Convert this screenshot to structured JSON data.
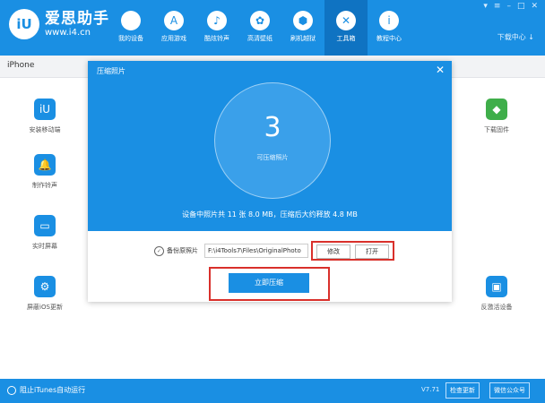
{
  "header": {
    "logo_badge": "iU",
    "logo_title": "爱思助手",
    "logo_url": "www.i4.cn",
    "nav": [
      {
        "label": "我的设备",
        "icon": "apple-icon",
        "glyph": ""
      },
      {
        "label": "应用游戏",
        "icon": "appstore-icon",
        "glyph": "A"
      },
      {
        "label": "酷炫铃声",
        "icon": "bell-icon",
        "glyph": "♪"
      },
      {
        "label": "高清壁纸",
        "icon": "flower-icon",
        "glyph": "✿"
      },
      {
        "label": "刷机越狱",
        "icon": "box-icon",
        "glyph": "⬢"
      },
      {
        "label": "工具箱",
        "icon": "wrench-icon",
        "glyph": "✕"
      },
      {
        "label": "教程中心",
        "icon": "info-icon",
        "glyph": "i"
      }
    ],
    "download_center": "下载中心 ↓",
    "window_controls": [
      "▾",
      "≡",
      "–",
      "□",
      "✕"
    ]
  },
  "tabs": {
    "active": "iPhone"
  },
  "tools_left": [
    {
      "label": "安装移动端",
      "color": "#1a8fe3",
      "glyph": "iU"
    },
    {
      "label": "制作铃声",
      "color": "#1a8fe3",
      "glyph": "🔔"
    },
    {
      "label": "实时屏幕",
      "color": "#1a8fe3",
      "glyph": "▭"
    },
    {
      "label": "屏蔽iOS更新",
      "color": "#1a8fe3",
      "glyph": "⚙"
    }
  ],
  "tool_right": {
    "label": "下载固件",
    "color": "#3fae4a",
    "glyph": "◆"
  },
  "tool_right_bottom": {
    "label": "反激活设备",
    "color": "#1a8fe3",
    "glyph": "▣"
  },
  "dialog": {
    "title": "压缩照片",
    "count": "3",
    "count_label": "可压缩照片",
    "info": "设备中照片共 11 张 8.0 MB，压缩后大约释放 4.8 MB",
    "backup_label": "备份原照片",
    "backup_path": "F:\\i4Tools7\\Files\\OriginalPhoto",
    "modify_label": "修改",
    "open_label": "打开",
    "compress_label": "立即压缩"
  },
  "footer": {
    "itunes_label": "阻止iTunes自动运行",
    "version": "V7.71",
    "update_label": "检查更新",
    "wechat_label": "微信公众号"
  }
}
